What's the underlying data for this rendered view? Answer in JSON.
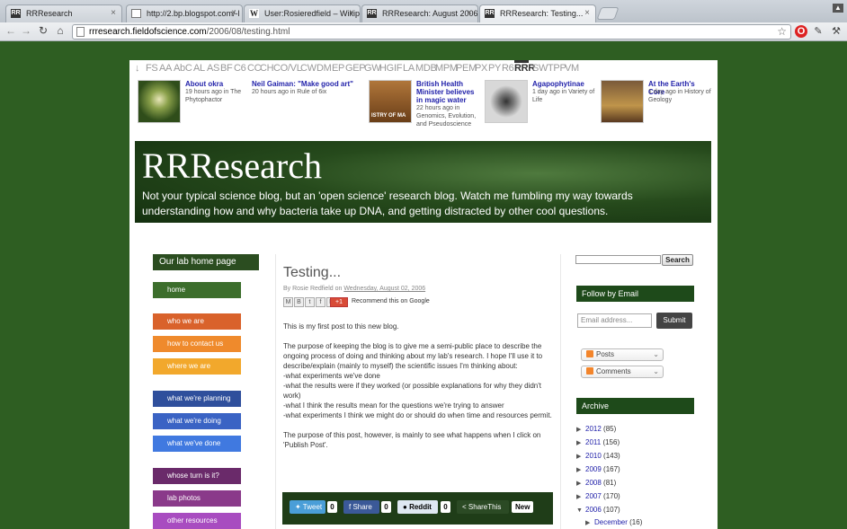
{
  "browser": {
    "tabs": [
      {
        "label": "RRResearch",
        "favicon": "rrr-icon"
      },
      {
        "label": "http://2.bp.blogspot.com/-l",
        "favicon": "page-icon"
      },
      {
        "label": "User:Rosieredfield – Wikipedi",
        "favicon": "wikipedia-icon"
      },
      {
        "label": "RRResearch: August 2006",
        "favicon": "rrr-icon"
      },
      {
        "label": "RRResearch: Testing...",
        "favicon": "rrr-icon"
      }
    ],
    "url_host": "rrresearch.fieldofscience.com",
    "url_path": "/2006/08/testing.html"
  },
  "network_nav": {
    "items": [
      "↓",
      "FS",
      "AA",
      "AbC",
      "AL",
      "AS",
      "BF",
      "C6",
      "CC",
      "CH",
      "CO/VL",
      "CW",
      "DM",
      "EP",
      "GEP",
      "GW",
      "HG",
      "IF",
      "LA",
      "MDB",
      "MPM",
      "PEM",
      "PX",
      "PY",
      "R6",
      "RRR",
      "SW",
      "TPP",
      "VM"
    ],
    "current": "RRR"
  },
  "feed": [
    {
      "title": "About okra",
      "meta": "19 hours ago in The Phytophactor"
    },
    {
      "title": "Neil Gaiman: \"Make good art\"",
      "meta": "20 hours ago in Rule of 6ix"
    },
    {
      "title": "British Health Minister believes in magic water",
      "meta": "22 hours ago in Genomics, Evolution, and Pseudoscience",
      "thumb_text": "ISTRY OF MA"
    },
    {
      "title": "Agapophytinae",
      "meta": "1 day ago in Variety of Life"
    },
    {
      "title": "At the Earth's Core",
      "meta": "1 day ago in History of Geology"
    }
  ],
  "header": {
    "title": "RRResearch",
    "description": "Not your typical science blog, but an 'open science' research blog. Watch me fumbling my way towards understanding how and why bacteria take up DNA, and getting distracted by other cool questions."
  },
  "sidebar_left": {
    "heading": "Our lab home page",
    "links": [
      {
        "label": "home",
        "color": "#3c6e2c"
      },
      {
        "label": "who we are",
        "color": "#d9622b"
      },
      {
        "label": "how to contact us",
        "color": "#ef8a2c"
      },
      {
        "label": "where we are",
        "color": "#f2a82c"
      },
      {
        "label": "what we're planning",
        "color": "#2f4f9c"
      },
      {
        "label": "what we're doing",
        "color": "#3a63c4"
      },
      {
        "label": "what we've done",
        "color": "#4079e0"
      },
      {
        "label": "whose turn is it?",
        "color": "#6a2a6a"
      },
      {
        "label": "lab photos",
        "color": "#8a3a8a"
      },
      {
        "label": "other resources",
        "color": "#a84cc0"
      }
    ]
  },
  "post": {
    "title": "Testing...",
    "byline_prefix": "By Rosie Redfield on ",
    "date": "Wednesday, August 02, 2006",
    "share_icons": [
      "M",
      "B",
      "t",
      "f",
      "P"
    ],
    "gplus_label": "+1",
    "recommend_label": "Recommend this on Google",
    "paragraphs": [
      "This is my first post to this new blog.",
      "The purpose of keeping the blog is to give me a semi-public place to describe the ongoing process of doing and thinking about my lab's research. I hope I'll use it to describe/explain (mainly to myself) the scientific issues I'm thinking about:\n-what experiments we've done\n-what the results were if they worked (or possible explanations for why they didn't work)\n-what I think the results mean for the questions we're trying to answer\n-what experiments I think we might do or should do when time and resources permit.",
      "The purpose of this post, however, is mainly to see what happens when I click on 'Publish Post'."
    ],
    "social": {
      "tweet_label": "Tweet",
      "tweet_count": "0",
      "share_label": "Share",
      "share_count": "0",
      "reddit_label": "Reddit",
      "reddit_count": "0",
      "sharethis_label": "ShareThis",
      "new_label": "New"
    }
  },
  "sidebar_right": {
    "search_button": "Search",
    "follow_heading": "Follow by Email",
    "email_placeholder": "Email address...",
    "submit_label": "Submit",
    "subscribe_posts": "Posts",
    "subscribe_comments": "Comments",
    "archive_heading": "Archive",
    "archive": [
      {
        "year": "2012",
        "count": "(85)",
        "expanded": false
      },
      {
        "year": "2011",
        "count": "(156)",
        "expanded": false
      },
      {
        "year": "2010",
        "count": "(143)",
        "expanded": false
      },
      {
        "year": "2009",
        "count": "(167)",
        "expanded": false
      },
      {
        "year": "2008",
        "count": "(81)",
        "expanded": false
      },
      {
        "year": "2007",
        "count": "(170)",
        "expanded": false
      },
      {
        "year": "2006",
        "count": "(107)",
        "expanded": true
      }
    ],
    "archive_month": {
      "month": "December",
      "count": "(16)"
    }
  }
}
